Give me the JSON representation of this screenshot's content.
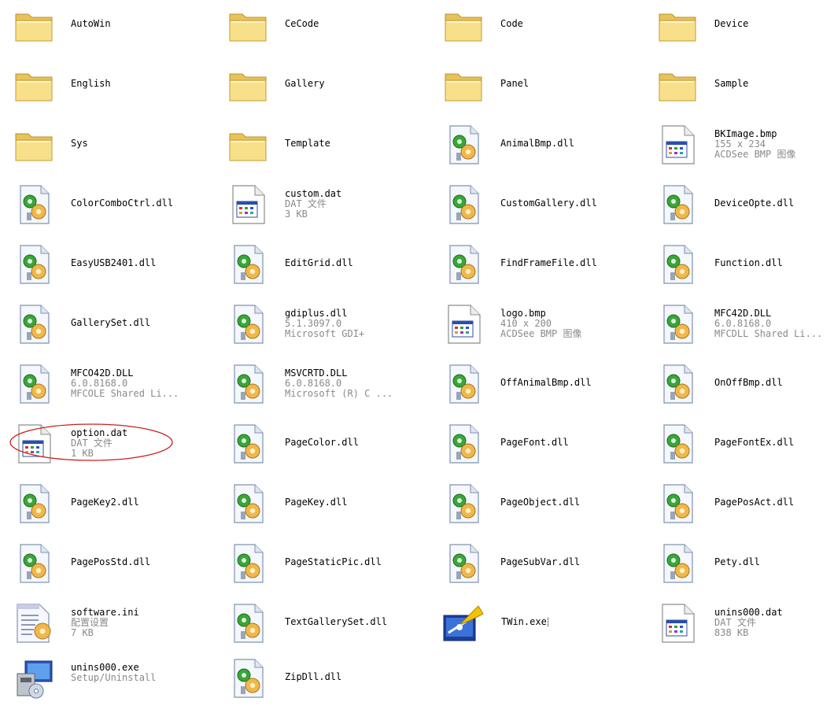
{
  "items": [
    {
      "name": "AutoWin",
      "type": "folder"
    },
    {
      "name": "CeCode",
      "type": "folder"
    },
    {
      "name": "Code",
      "type": "folder"
    },
    {
      "name": "Device",
      "type": "folder"
    },
    {
      "name": "English",
      "type": "folder"
    },
    {
      "name": "Gallery",
      "type": "folder"
    },
    {
      "name": "Panel",
      "type": "folder"
    },
    {
      "name": "Sample",
      "type": "folder"
    },
    {
      "name": "Sys",
      "type": "folder"
    },
    {
      "name": "Template",
      "type": "folder"
    },
    {
      "name": "AnimalBmp.dll",
      "type": "dll"
    },
    {
      "name": "BKImage.bmp",
      "line2": "155 x 234",
      "line3": "ACDSee BMP 图像",
      "type": "bmp"
    },
    {
      "name": "ColorComboCtrl.dll",
      "type": "dll"
    },
    {
      "name": "custom.dat",
      "line2": "DAT 文件",
      "line3": "3 KB",
      "type": "dat"
    },
    {
      "name": "CustomGallery.dll",
      "type": "dll"
    },
    {
      "name": "DeviceOpte.dll",
      "type": "dll"
    },
    {
      "name": "EasyUSB2401.dll",
      "type": "dll"
    },
    {
      "name": "EditGrid.dll",
      "type": "dll"
    },
    {
      "name": "FindFrameFile.dll",
      "type": "dll"
    },
    {
      "name": "Function.dll",
      "type": "dll"
    },
    {
      "name": "GallerySet.dll",
      "type": "dll"
    },
    {
      "name": "gdiplus.dll",
      "line2": "5.1.3097.0",
      "line3": "Microsoft GDI+",
      "type": "dll"
    },
    {
      "name": "logo.bmp",
      "line2": "410 x 200",
      "line3": "ACDSee BMP 图像",
      "type": "bmp"
    },
    {
      "name": "MFC42D.DLL",
      "line2": "6.0.8168.0",
      "line3": "MFCDLL Shared Li...",
      "type": "dll"
    },
    {
      "name": "MFCO42D.DLL",
      "line2": "6.0.8168.0",
      "line3": "MFCOLE Shared Li...",
      "type": "dll"
    },
    {
      "name": "MSVCRTD.DLL",
      "line2": "6.0.8168.0",
      "line3": "Microsoft (R) C ...",
      "type": "dll"
    },
    {
      "name": "OffAnimalBmp.dll",
      "type": "dll"
    },
    {
      "name": "OnOffBmp.dll",
      "type": "dll"
    },
    {
      "name": "option.dat",
      "line2": "DAT 文件",
      "line3": "1 KB",
      "type": "dat",
      "circled": true
    },
    {
      "name": "PageColor.dll",
      "type": "dll"
    },
    {
      "name": "PageFont.dll",
      "type": "dll"
    },
    {
      "name": "PageFontEx.dll",
      "type": "dll"
    },
    {
      "name": "PageKey2.dll",
      "type": "dll"
    },
    {
      "name": "PageKey.dll",
      "type": "dll"
    },
    {
      "name": "PageObject.dll",
      "type": "dll"
    },
    {
      "name": "PagePosAct.dll",
      "type": "dll"
    },
    {
      "name": "PagePosStd.dll",
      "type": "dll"
    },
    {
      "name": "PageStaticPic.dll",
      "type": "dll"
    },
    {
      "name": "PageSubVar.dll",
      "type": "dll"
    },
    {
      "name": "Pety.dll",
      "type": "dll"
    },
    {
      "name": "software.ini",
      "line2": "配置设置",
      "line3": "7 KB",
      "type": "ini"
    },
    {
      "name": "TextGallerySet.dll",
      "type": "dll"
    },
    {
      "name": "TWin.exe",
      "type": "exe",
      "selected": true
    },
    {
      "name": "unins000.dat",
      "line2": "DAT 文件",
      "line3": "838 KB",
      "type": "dat"
    },
    {
      "name": "unins000.exe",
      "line2": "Setup/Uninstall",
      "type": "setup"
    },
    {
      "name": "ZipDll.dll",
      "type": "dll"
    }
  ],
  "colors": {
    "annotation": "#cc1e1e",
    "secondary_text": "#8a8a8a"
  }
}
